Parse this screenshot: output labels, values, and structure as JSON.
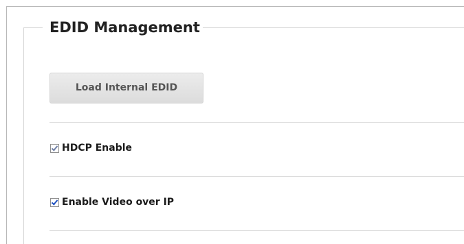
{
  "section": {
    "title": "EDID Management"
  },
  "buttons": {
    "load_internal_edid": "Load Internal EDID"
  },
  "options": [
    {
      "label": "HDCP Enable",
      "checked": true
    },
    {
      "label": "Enable Video over IP",
      "checked": true
    }
  ],
  "colors": {
    "checkmark": "#1d4fbf",
    "button_bg": "#e4e4e4",
    "border": "#b9b9b9"
  }
}
